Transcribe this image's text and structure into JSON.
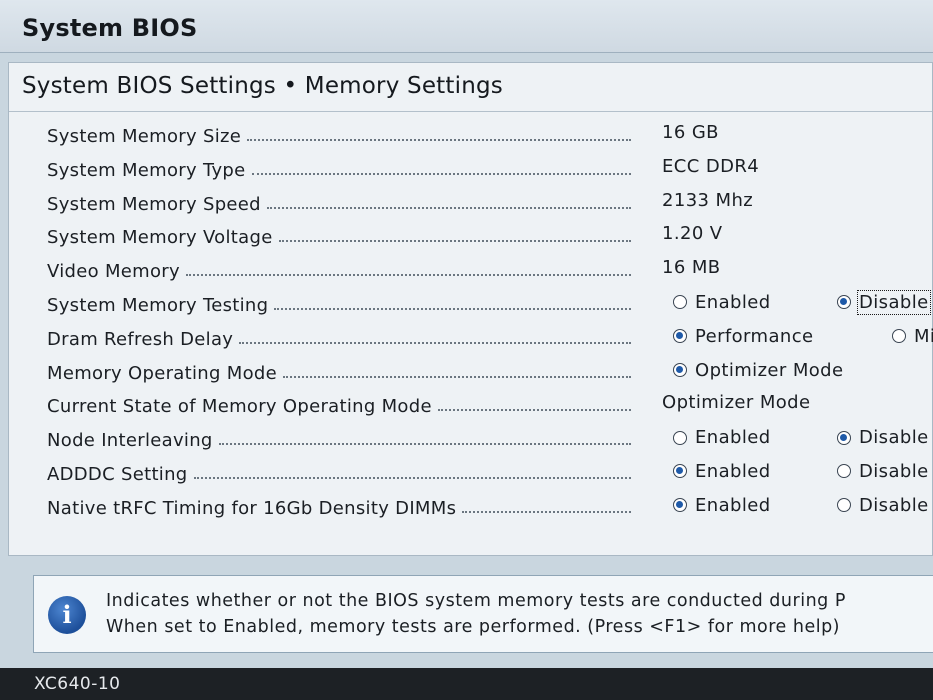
{
  "header": {
    "title": "System BIOS"
  },
  "panel": {
    "title": "System BIOS Settings • Memory Settings"
  },
  "settings": [
    {
      "label": "System Memory Size",
      "value": "16 GB"
    },
    {
      "label": "System Memory Type",
      "value": "ECC DDR4"
    },
    {
      "label": "System Memory Speed",
      "value": "2133 Mhz"
    },
    {
      "label": "System Memory Voltage",
      "value": "1.20 V"
    },
    {
      "label": "Video Memory",
      "value": "16 MB"
    },
    {
      "label": "System Memory Testing",
      "option1": "Enabled",
      "option2": "Disable",
      "selected": 2,
      "focused": 2
    },
    {
      "label": "Dram Refresh Delay",
      "option1": "Performance",
      "option2": "Mi",
      "selected": 1
    },
    {
      "label": "Memory Operating Mode",
      "option1": "Optimizer Mode",
      "selected": 1
    },
    {
      "label": "Current State of Memory Operating Mode",
      "value": "Optimizer Mode"
    },
    {
      "label": "Node Interleaving",
      "option1": "Enabled",
      "option2": "Disable",
      "selected": 2
    },
    {
      "label": "ADDDC Setting",
      "option1": "Enabled",
      "option2": "Disable",
      "selected": 1
    },
    {
      "label": "Native tRFC Timing for 16Gb Density DIMMs",
      "option1": "Enabled",
      "option2": "Disable",
      "selected": 1
    }
  ],
  "help": {
    "icon": "info-icon",
    "line1": "Indicates whether or not the BIOS system memory tests are conducted during P",
    "line2": "When set to Enabled, memory tests are performed. (Press <F1> for more help)"
  },
  "footer": {
    "text": "XC640-10"
  },
  "colors": {
    "accent": "#1f5aa8",
    "background": "#c9d6df",
    "footer": "#1d2125"
  }
}
